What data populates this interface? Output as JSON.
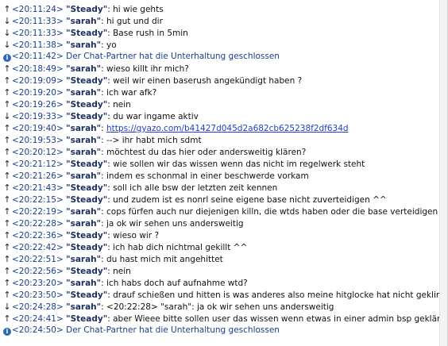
{
  "messages": [
    {
      "dir": "up",
      "time": "<20:11:24>",
      "nick": "\"Steady\"",
      "text": "hi wie gehts"
    },
    {
      "dir": "down",
      "time": "<20:11:33>",
      "nick": "\"sarah\"",
      "text": "hi gut und dir"
    },
    {
      "dir": "down",
      "time": "<20:11:33>",
      "nick": "\"Steady\"",
      "text": "Base rush in 5min"
    },
    {
      "dir": "down",
      "time": "<20:11:38>",
      "nick": "\"sarah\"",
      "text": "yo"
    },
    {
      "dir": "info",
      "time": "<20:11:42>",
      "system": "Der Chat-Partner hat die Unterhaltung geschlossen"
    },
    {
      "dir": "up",
      "time": "<20:18:49>",
      "nick": "\"sarah\"",
      "text": "wieso killt ihr mich?"
    },
    {
      "dir": "up",
      "time": "<20:19:09>",
      "nick": "\"Steady\"",
      "text": "weil wir  einen baserush angekündigt haben ?"
    },
    {
      "dir": "up",
      "time": "<20:19:20>",
      "nick": "\"sarah\"",
      "text": "ich war afk?"
    },
    {
      "dir": "up",
      "time": "<20:19:26>",
      "nick": "\"Steady\"",
      "text": "nein"
    },
    {
      "dir": "down",
      "time": "<20:19:33>",
      "nick": "\"Steady\"",
      "text": "du war ingame aktiv"
    },
    {
      "dir": "up",
      "time": "<20:19:40>",
      "nick": "\"sarah\"",
      "link": "https://gyazo.com/b41427d045d2a682cb625238f2df634d"
    },
    {
      "dir": "up",
      "time": "<20:19:53>",
      "nick": "\"sarah\"",
      "text": "--> ihr habt mich sdmt"
    },
    {
      "dir": "up",
      "time": "<20:20:12>",
      "nick": "\"sarah\"",
      "text": "möchtest du das hier oder andersweitig klären?"
    },
    {
      "dir": "up",
      "time": "<20:21:12>",
      "nick": "\"Steady\"",
      "text": "wie sollen wir das wissen wenn das  nicht im regelwerk steht"
    },
    {
      "dir": "up",
      "time": "<20:21:26>",
      "nick": "\"sarah\"",
      "text": "indem es schonmal in einer beschwerde vorkam"
    },
    {
      "dir": "up",
      "time": "<20:21:43>",
      "nick": "\"Steady\"",
      "text": "soll ich alle bsw der letzten zeit kennen"
    },
    {
      "dir": "up",
      "time": "<20:22:15>",
      "nick": "\"Steady\"",
      "text": "und zudem ist es nonrl  seine eigene base nicht zuverteidigen ^^"
    },
    {
      "dir": "up",
      "time": "<20:22:19>",
      "nick": "\"sarah\"",
      "text": "cops fürfen auch nur diejenigen killn, die wtds haben oder die base verteidigen"
    },
    {
      "dir": "up",
      "time": "<20:22:28>",
      "nick": "\"sarah\"",
      "text": "ja ok wir sehen uns andersweitig"
    },
    {
      "dir": "up",
      "time": "<20:22:36>",
      "nick": "\"Steady\"",
      "text": "wieso wir ?"
    },
    {
      "dir": "up",
      "time": "<20:22:42>",
      "nick": "\"Steady\"",
      "text": "ich hab dich nichtmal gekillt ^^"
    },
    {
      "dir": "up",
      "time": "<20:22:51>",
      "nick": "\"sarah\"",
      "text": "du hast mich mit angehittet"
    },
    {
      "dir": "up",
      "time": "<20:22:56>",
      "nick": "\"Steady\"",
      "text": "nein"
    },
    {
      "dir": "up",
      "time": "<20:23:20>",
      "nick": "\"sarah\"",
      "text": "ich habs doch auf aufnahme wtd?"
    },
    {
      "dir": "up",
      "time": "<20:23:50>",
      "nick": "\"Steady\"",
      "text": "drauf schießen und hitten is was anderes also meine hitglocke hat nicht geklingelt"
    },
    {
      "dir": "down",
      "time": "<20:24:28>",
      "nick": "\"sarah\"",
      "text": "<20:22:28> \"sarah\": ja ok wir sehen uns andersweitig"
    },
    {
      "dir": "up",
      "time": "<20:24:41>",
      "nick": "\"Steady\"",
      "text": "aber Wieee bitte sollen user das wissen wenn etwas in einer admin   bsp geklärt wird"
    },
    {
      "dir": "info",
      "time": "<20:24:50>",
      "system": "Der Chat-Partner hat die Unterhaltung geschlossen"
    }
  ]
}
